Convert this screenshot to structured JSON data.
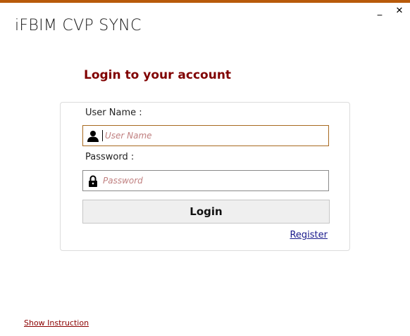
{
  "window": {
    "minimize_label": "_",
    "close_label": "✕",
    "accent_color": "#b85a0a"
  },
  "app": {
    "title": "iFBIM CVP SYNC"
  },
  "login": {
    "heading": "Login to your account",
    "heading_color": "#800000",
    "username_label": "User Name :",
    "username_placeholder": "User Name",
    "username_value": "",
    "username_icon": "user-icon",
    "password_label": "Password :",
    "password_placeholder": "Password",
    "password_value": "",
    "password_icon": "lock-icon",
    "login_button_label": "Login",
    "register_link_label": "Register"
  },
  "footer": {
    "show_instruction_label": "Show Instruction"
  }
}
